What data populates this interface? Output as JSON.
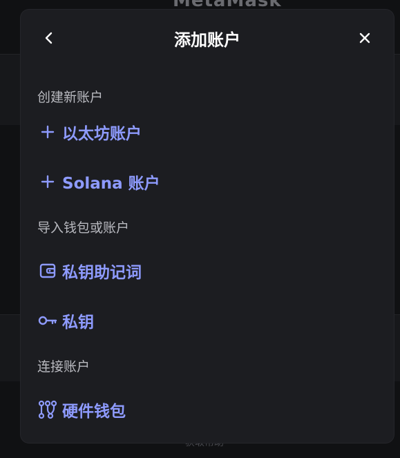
{
  "background": {
    "logo_text": "MetaMask",
    "footer_text": "获取帮助"
  },
  "modal": {
    "title": "添加账户",
    "sections": {
      "create": {
        "label": "创建新账户",
        "ethereum_label": "以太坊账户",
        "solana_label": "Solana 账户"
      },
      "import": {
        "label": "导入钱包或账户",
        "srp_label": "私钥助记词",
        "private_key_label": "私钥"
      },
      "connect": {
        "label": "连接账户",
        "hardware_label": "硬件钱包"
      }
    }
  },
  "colors": {
    "accent": "#8e9bff",
    "modal_bg": "#1c1d21",
    "section_text": "#b9bac0",
    "title_text": "#ffffff"
  },
  "icons": {
    "back": "chevron-left-icon",
    "close": "close-icon",
    "add": "plus-icon",
    "wallet": "wallet-icon",
    "key": "key-icon",
    "hardware": "hardware-wallet-icon"
  }
}
